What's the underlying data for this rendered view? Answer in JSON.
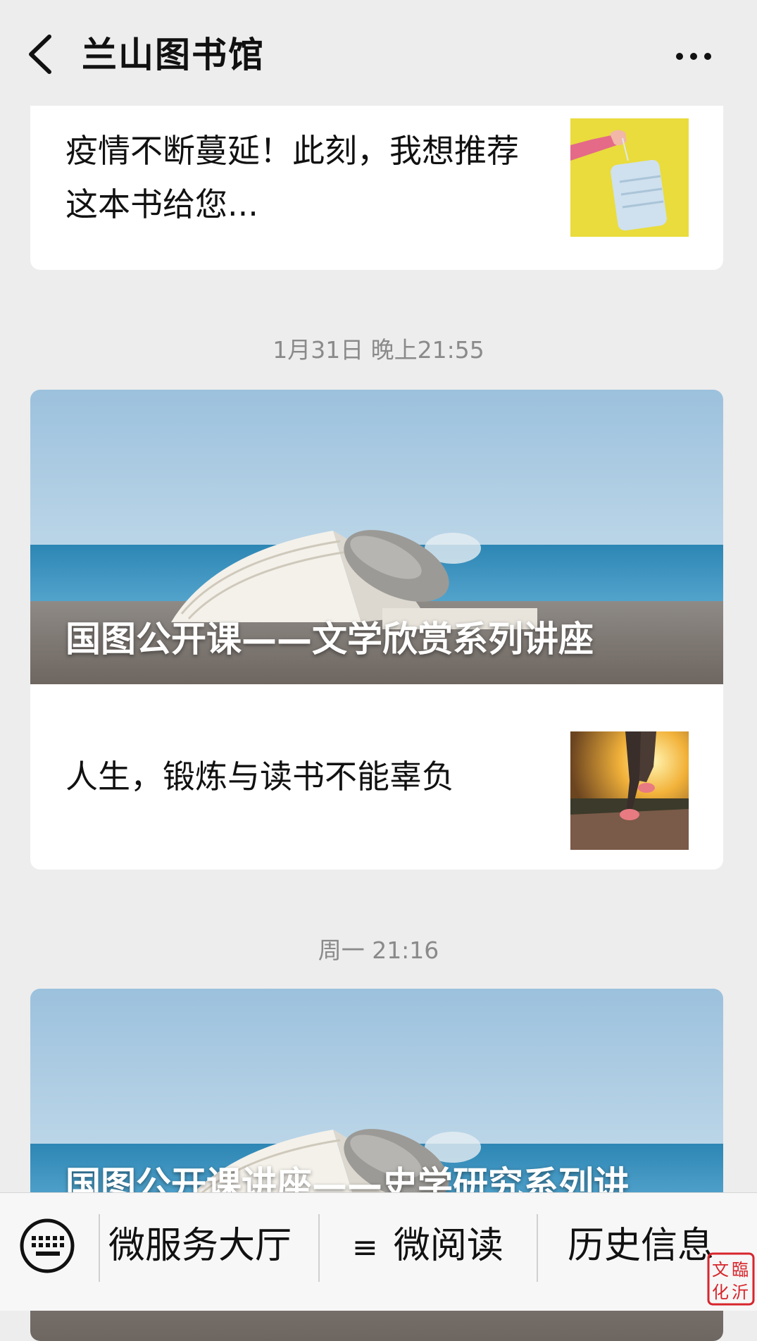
{
  "header": {
    "title": "兰山图书馆",
    "back_icon": "chevron-left-icon",
    "more_icon": "more-dots-icon"
  },
  "feed": {
    "card1": {
      "text": "疫情不断蔓延！此刻，我想推荐这本书给您...",
      "thumb": "face-mask-photo"
    },
    "timestamp1": "1月31日 晚上21:55",
    "card2": {
      "cover_title": "国图公开课——文学欣赏系列讲座",
      "row_text": "人生，锻炼与读书不能辜负",
      "thumb": "runner-photo"
    },
    "timestamp2": "周一 21:16",
    "card3": {
      "cover_title": "国图公开课讲座——史学研究系列讲"
    }
  },
  "bottom_menu": {
    "keyboard_icon": "keyboard-icon",
    "items": [
      {
        "label": "微服务大厅"
      },
      {
        "icon": "≡",
        "label": "微阅读"
      },
      {
        "label": "历史信息"
      }
    ]
  },
  "watermark": {
    "text": "臨沂文化"
  },
  "colors": {
    "background": "#ededed",
    "card": "#ffffff",
    "timestamp": "#8a8a8a"
  }
}
